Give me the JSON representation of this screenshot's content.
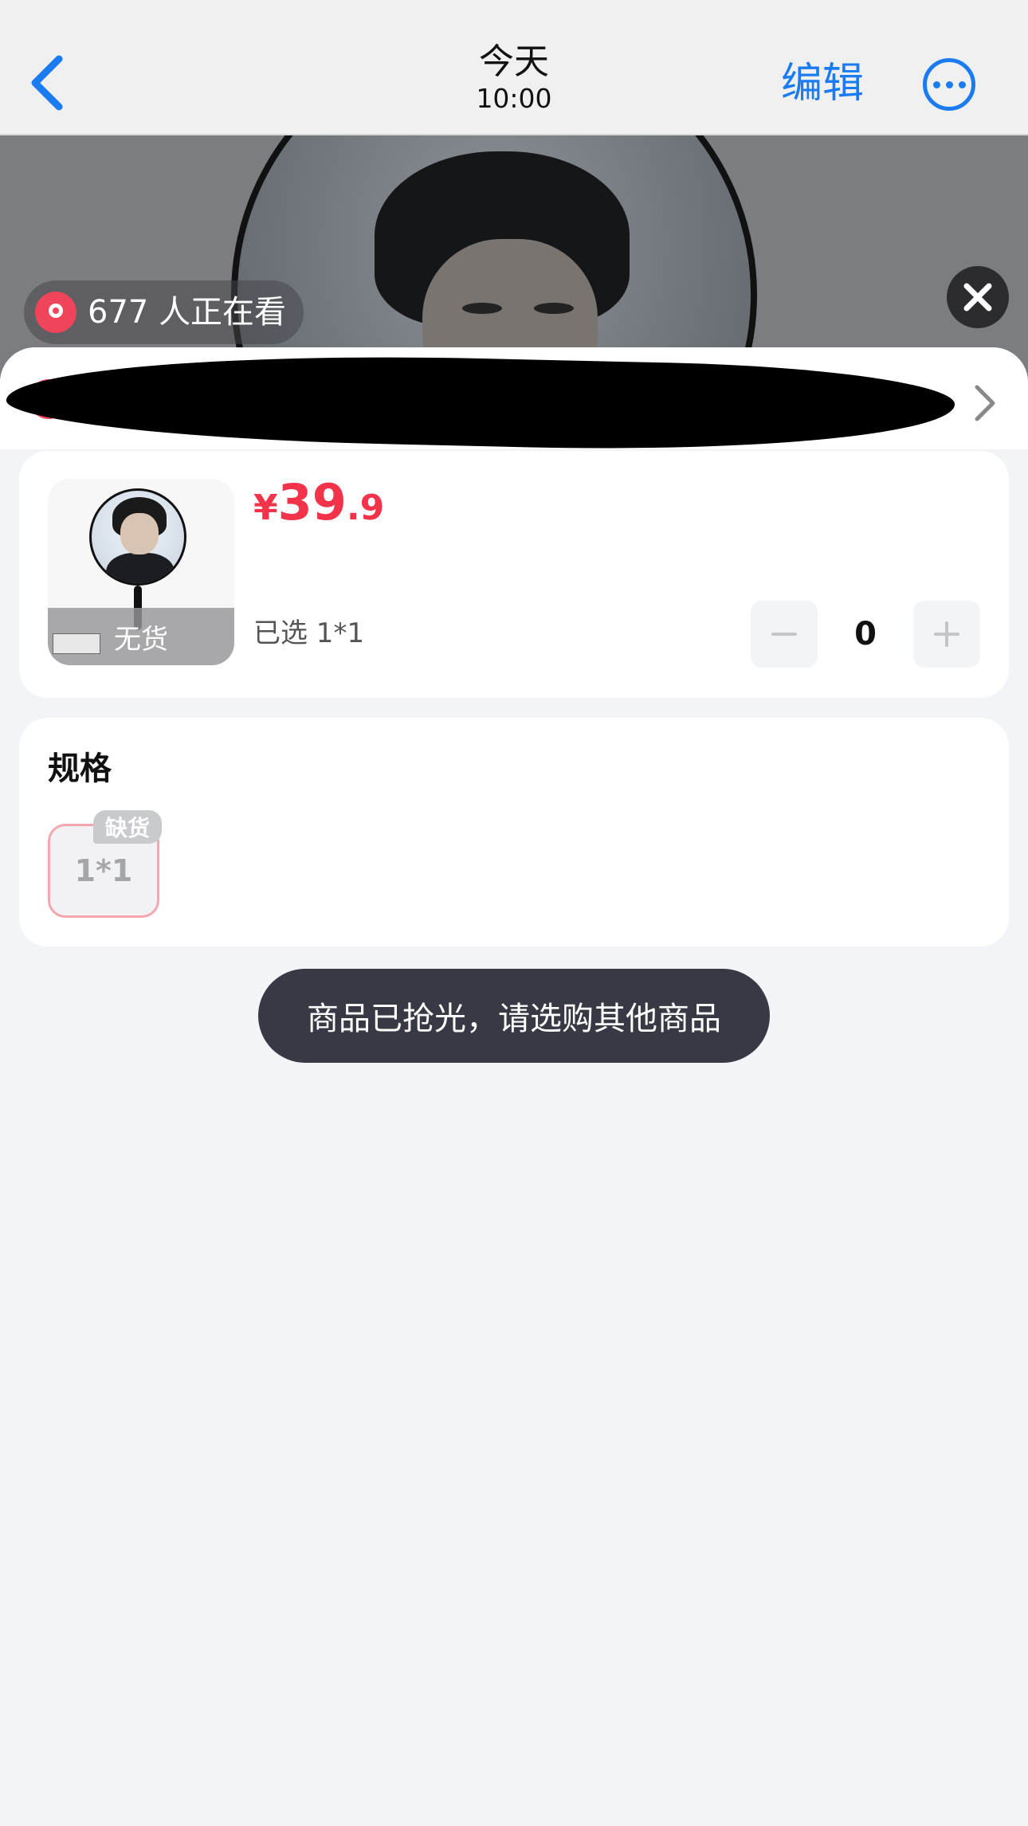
{
  "nav": {
    "back_icon": "chevron-left-icon",
    "title_day": "今天",
    "title_time": "10:00",
    "edit_label": "编辑",
    "more_icon": "more-dots-icon",
    "accent_color": "#1a7cf0"
  },
  "live": {
    "viewer_text": "677 人正在看",
    "close_icon": "close-icon"
  },
  "store": {
    "name_redacted": true,
    "chevron_icon": "chevron-right-icon"
  },
  "product": {
    "price_symbol": "¥",
    "price_integer": "39",
    "price_decimal": ".9",
    "price_color": "#f2334a",
    "stock_status": "无货",
    "selected_label": "已选 1*1",
    "quantity": "0",
    "minus_icon": "minus-icon",
    "plus_icon": "plus-icon"
  },
  "spec": {
    "title": "规格",
    "options": [
      {
        "label": "1*1",
        "badge": "缺货"
      }
    ]
  },
  "toast": {
    "message": "商品已抢光，请选购其他商品"
  }
}
